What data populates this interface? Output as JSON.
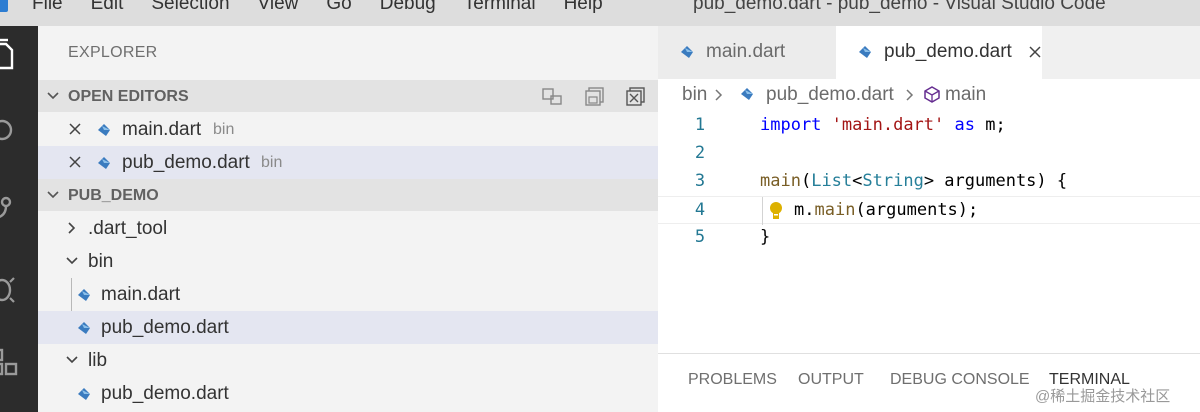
{
  "window": {
    "title": "pub_demo.dart - pub_demo - Visual Studio Code",
    "menu": [
      "File",
      "Edit",
      "Selection",
      "View",
      "Go",
      "Debug",
      "Terminal",
      "Help"
    ]
  },
  "activity_bar": {
    "icons": [
      "explorer-icon",
      "search-icon",
      "source-control-icon",
      "debug-icon",
      "extensions-icon"
    ]
  },
  "sidebar": {
    "title": "EXPLORER",
    "open_editors": {
      "label": "OPEN EDITORS",
      "tools": [
        "new-untitled-file-icon",
        "save-all-icon",
        "close-all-icon"
      ],
      "items": [
        {
          "name": "main.dart",
          "folder": "bin"
        },
        {
          "name": "pub_demo.dart",
          "folder": "bin"
        }
      ]
    },
    "project": {
      "label": "PUB_DEMO",
      "tree": [
        {
          "name": ".dart_tool",
          "type": "folder",
          "expanded": false
        },
        {
          "name": "bin",
          "type": "folder",
          "expanded": true
        },
        {
          "name": "main.dart",
          "type": "file"
        },
        {
          "name": "pub_demo.dart",
          "type": "file",
          "selected": true
        },
        {
          "name": "lib",
          "type": "folder",
          "expanded": true
        },
        {
          "name": "pub_demo.dart",
          "type": "file"
        }
      ]
    }
  },
  "editor": {
    "tabs": [
      {
        "label": "main.dart",
        "active": false
      },
      {
        "label": "pub_demo.dart",
        "active": true
      }
    ],
    "breadcrumb": [
      "bin",
      "pub_demo.dart",
      "main"
    ],
    "lines": [
      {
        "number": "1"
      },
      {
        "number": "2"
      },
      {
        "number": "3"
      },
      {
        "number": "4"
      },
      {
        "number": "5"
      }
    ],
    "code": {
      "l1": {
        "kw_import": "import",
        "str": "'main.dart'",
        "kw_as": "as",
        "rest": " m;"
      },
      "l3": {
        "fn": "main",
        "p1": "(",
        "ty1": "List",
        "p2": "<",
        "ty2": "String",
        "p3": "> arguments) {"
      },
      "l4": {
        "obj": "m.",
        "fn": "main",
        "rest": "(arguments);"
      },
      "l5": {
        "text": "}"
      }
    }
  },
  "panel": {
    "tabs": [
      "PROBLEMS",
      "OUTPUT",
      "DEBUG CONSOLE",
      "TERMINAL"
    ],
    "active": "TERMINAL"
  },
  "watermark": "@稀土掘金技术社区",
  "colors": {
    "dart_blue": "#3a7bbf",
    "keyword": "#0000ff",
    "string": "#a31515",
    "type": "#267f99",
    "function": "#795e26",
    "line_number": "#237893"
  }
}
